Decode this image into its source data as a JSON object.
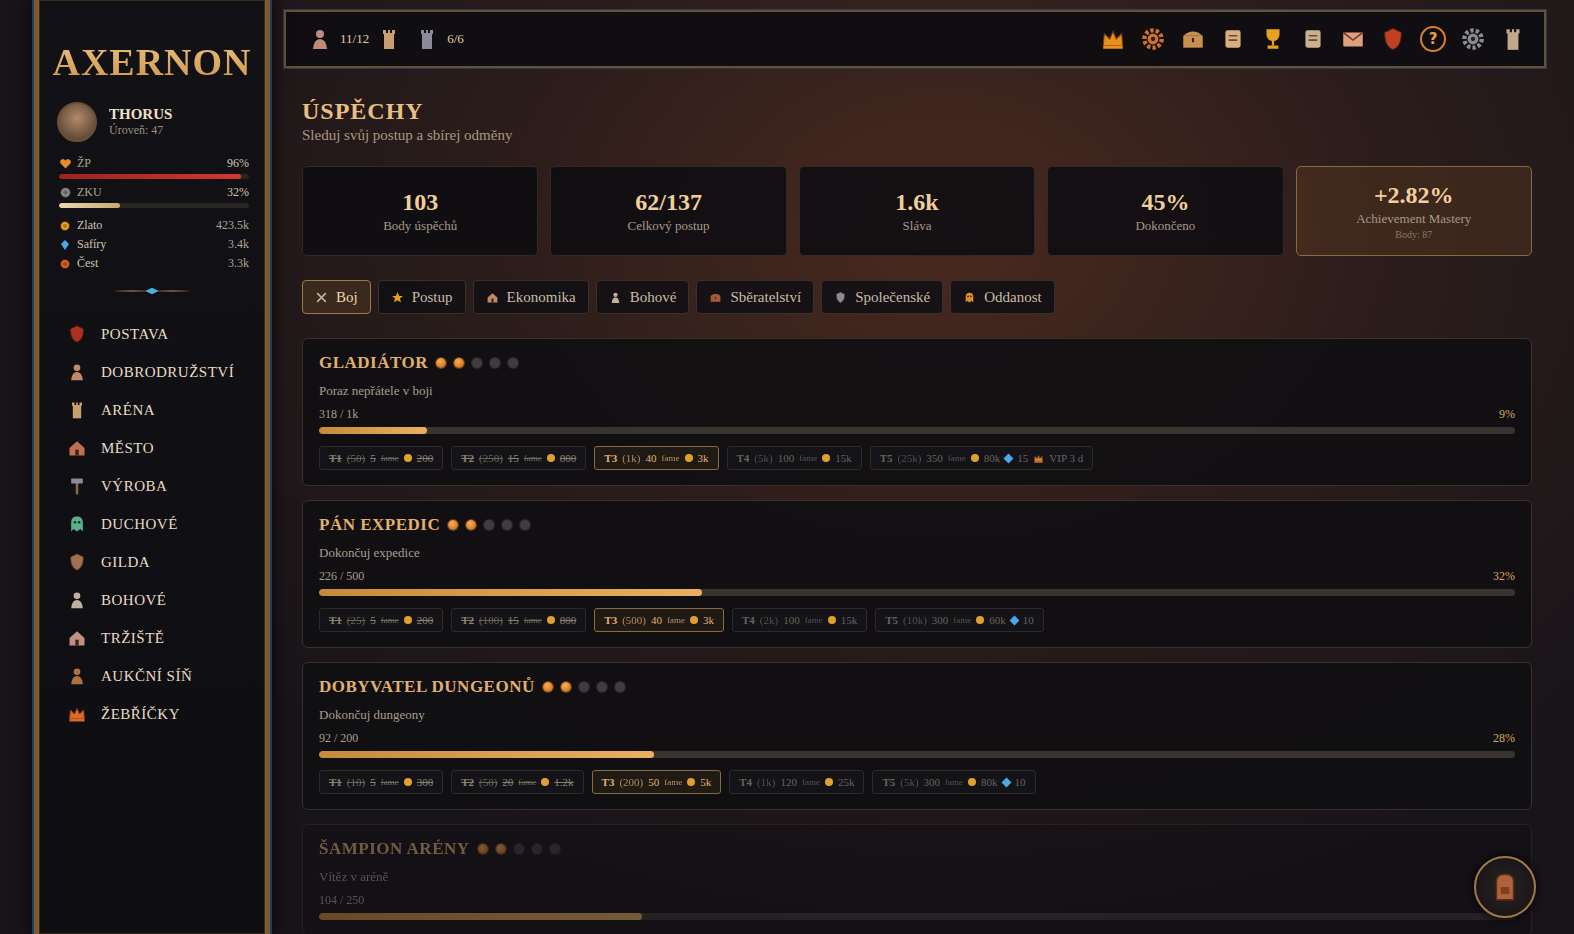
{
  "sidebar": {
    "logo": "AXERNON",
    "player": {
      "name": "THORUS",
      "level": "Úroveň: 47"
    },
    "vitals": [
      {
        "label": "ŽP",
        "value": "96%",
        "level": 0.96
      },
      {
        "label": "ZKU",
        "value": "32%",
        "level": 0.32
      }
    ],
    "currencies": [
      {
        "label": "Zlato",
        "value": "423.5k"
      },
      {
        "label": "Safíry",
        "value": "3.4k"
      },
      {
        "label": "Čest",
        "value": "3.3k"
      }
    ],
    "items": [
      {
        "label": "POSTAVA",
        "selected": false
      },
      {
        "label": "DOBRODRUŽSTVÍ",
        "selected": false
      },
      {
        "label": "ARÉNA",
        "selected": false
      },
      {
        "label": "MĚSTO",
        "selected": false
      },
      {
        "label": "VÝROBA",
        "selected": false
      },
      {
        "label": "DUCHOVÉ",
        "selected": false
      },
      {
        "label": "GILDA",
        "selected": false
      },
      {
        "label": "BOHOVÉ",
        "selected": false
      },
      {
        "label": "TRŽIŠTĚ",
        "selected": false
      },
      {
        "label": "AUKČNÍ SÍŇ",
        "selected": false
      },
      {
        "label": "ŽEBŘÍČKY",
        "selected": false
      }
    ]
  },
  "topbar": {
    "resources": [
      "11/12",
      "6/6"
    ],
    "help_glyph": "?"
  },
  "page": {
    "title": "ÚSPĚCHY",
    "subtitle": "Sleduj svůj postup a sbírej odměny"
  },
  "stats": [
    {
      "value": "103",
      "label": "Body úspěchů",
      "highlighted": false
    },
    {
      "value": "62/137",
      "label": "Celkový postup",
      "highlighted": false
    },
    {
      "value": "1.6k",
      "label": "Sláva",
      "highlighted": false
    },
    {
      "value": "45%",
      "label": "Dokončeno",
      "highlighted": false
    },
    {
      "value": "+2.82%",
      "label": "Achievement Mastery",
      "sub": "Body: 87",
      "highlighted": true
    }
  ],
  "tabs": [
    {
      "label": "Boj",
      "selected": true
    },
    {
      "label": "Postup",
      "selected": false
    },
    {
      "label": "Ekonomika",
      "selected": false
    },
    {
      "label": "Bohové",
      "selected": false
    },
    {
      "label": "Sběratelství",
      "selected": false
    },
    {
      "label": "Společenské",
      "selected": false
    },
    {
      "label": "Oddanost",
      "selected": false
    }
  ],
  "achievements": [
    {
      "name": "GLADIÁTOR",
      "stars": 2,
      "description": "Poraz nepřátele v boji",
      "progress": "318 / 1k",
      "percent": "9%",
      "level": 0.09,
      "faded": false,
      "tiers": [
        {
          "tier": "T1",
          "req": "(50)",
          "fame": "5",
          "fame_unit": "fame",
          "gold": "200",
          "status": "claimed"
        },
        {
          "tier": "T2",
          "req": "(250)",
          "fame": "15",
          "fame_unit": "fame",
          "gold": "800",
          "status": "claimed"
        },
        {
          "tier": "T3",
          "req": "(1k)",
          "fame": "40",
          "fame_unit": "fame",
          "gold": "3k",
          "status": "current"
        },
        {
          "tier": "T4",
          "req": "(5k)",
          "fame": "100",
          "fame_unit": "fame",
          "gold": "15k",
          "status": "locked"
        },
        {
          "tier": "T5",
          "req": "(25k)",
          "fame": "350",
          "fame_unit": "fame",
          "gold": "80k",
          "sapphires": "15",
          "vip": "VIP 3 d",
          "status": "locked"
        }
      ]
    },
    {
      "name": "PÁN EXPEDIC",
      "stars": 2,
      "description": "Dokončuj expedice",
      "progress": "226 / 500",
      "percent": "32%",
      "level": 0.32,
      "faded": false,
      "tiers": [
        {
          "tier": "T1",
          "req": "(25)",
          "fame": "5",
          "fame_unit": "fame",
          "gold": "200",
          "status": "claimed"
        },
        {
          "tier": "T2",
          "req": "(100)",
          "fame": "15",
          "fame_unit": "fame",
          "gold": "800",
          "status": "claimed"
        },
        {
          "tier": "T3",
          "req": "(500)",
          "fame": "40",
          "fame_unit": "fame",
          "gold": "3k",
          "status": "current"
        },
        {
          "tier": "T4",
          "req": "(2k)",
          "fame": "100",
          "fame_unit": "fame",
          "gold": "15k",
          "status": "locked"
        },
        {
          "tier": "T5",
          "req": "(10k)",
          "fame": "300",
          "fame_unit": "fame",
          "gold": "60k",
          "sapphires": "10",
          "status": "locked"
        }
      ]
    },
    {
      "name": "DOBYVATEL DUNGEONŮ",
      "stars": 2,
      "description": "Dokončuj dungeony",
      "progress": "92 / 200",
      "percent": "28%",
      "level": 0.28,
      "faded": false,
      "tiers": [
        {
          "tier": "T1",
          "req": "(10)",
          "fame": "5",
          "fame_unit": "fame",
          "gold": "300",
          "status": "claimed"
        },
        {
          "tier": "T2",
          "req": "(50)",
          "fame": "20",
          "fame_unit": "fame",
          "gold": "1.2k",
          "status": "claimed"
        },
        {
          "tier": "T3",
          "req": "(200)",
          "fame": "50",
          "fame_unit": "fame",
          "gold": "5k",
          "status": "current"
        },
        {
          "tier": "T4",
          "req": "(1k)",
          "fame": "120",
          "fame_unit": "fame",
          "gold": "25k",
          "status": "locked"
        },
        {
          "tier": "T5",
          "req": "(5k)",
          "fame": "300",
          "fame_unit": "fame",
          "gold": "80k",
          "sapphires": "10",
          "status": "locked"
        }
      ]
    },
    {
      "name": "ŠAMPION ARÉNY",
      "stars": 2,
      "description": "Vítěz v aréně",
      "progress": "104 / 250",
      "percent": "27%",
      "level": 0.27,
      "faded": true,
      "tiers": []
    }
  ]
}
